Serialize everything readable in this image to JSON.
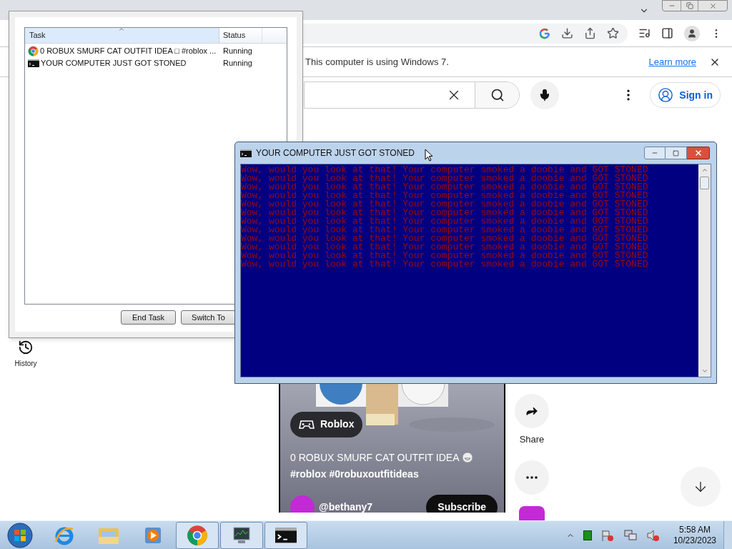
{
  "browser": {
    "infobar": {
      "message": "This computer is using Windows 7.",
      "link": "Learn more"
    },
    "youtube": {
      "sign_in": "Sign in",
      "sidebar": [
        {
          "label": "History"
        }
      ],
      "short": {
        "chip": "Roblox",
        "title_line1": "0 ROBUX SMURF CAT OUTFIT IDEA",
        "title_line2": "#roblox #0robuxoutfitideas",
        "channel": "@bethany7",
        "subscribe": "Subscribe"
      },
      "actions": [
        {
          "kind": "share",
          "label": "Share"
        },
        {
          "kind": "more"
        }
      ]
    }
  },
  "task_manager": {
    "columns": [
      "Task",
      "Status"
    ],
    "rows": [
      {
        "kind": "chrome",
        "task": "0 ROBUX SMURF CAT OUTFIT IDEA □ #roblox ...",
        "status": "Running"
      },
      {
        "kind": "console",
        "task": "YOUR COMPUTER JUST GOT STONED",
        "status": "Running"
      }
    ],
    "buttons": [
      "End Task",
      "Switch To"
    ]
  },
  "console": {
    "title": "YOUR COMPUTER JUST GOT STONED",
    "lines": [
      "Wow, would you look at that! Your computer smoked a doobie and GOT STONED",
      "Wow, would you look at that! Your computer smoked a doobie and GOT STONED",
      "Wow, would you look at that! Your computer smoked a doobie and GOT STONED",
      "Wow, would you look at that! Your computer smoked a doobie and GOT STONED",
      "Wow, would you look at that! Your computer smoked a doobie and GOT STONED",
      "Wow, would you look at that! Your computer smoked a doobie and GOT STONED",
      "Wow, would you look at that! Your computer smoked a doobie and GOT STONED",
      "Wow, would you look at that! Your computer smoked a doobie and GOT STONED",
      "Wow, would you look at that! Your computer smoked a doobie and GOT STONED",
      "Wow, would you look at that! Your computer smoked a doobie and GOT STONED",
      "Wow, would you look at that! Your computer smoked a doobie and GOT STONED",
      "Wow, would you look at that! Your computer smoked a doobie and GOT STONED"
    ]
  },
  "taskbar": {
    "apps": [
      {
        "kind": "ie",
        "running": false
      },
      {
        "kind": "explorer",
        "running": false
      },
      {
        "kind": "media",
        "running": false
      },
      {
        "kind": "chrome",
        "running": true
      },
      {
        "kind": "taskmgr",
        "running": true
      },
      {
        "kind": "console",
        "running": true
      }
    ],
    "clock": {
      "time": "5:58 AM",
      "date": "10/23/2023"
    }
  }
}
